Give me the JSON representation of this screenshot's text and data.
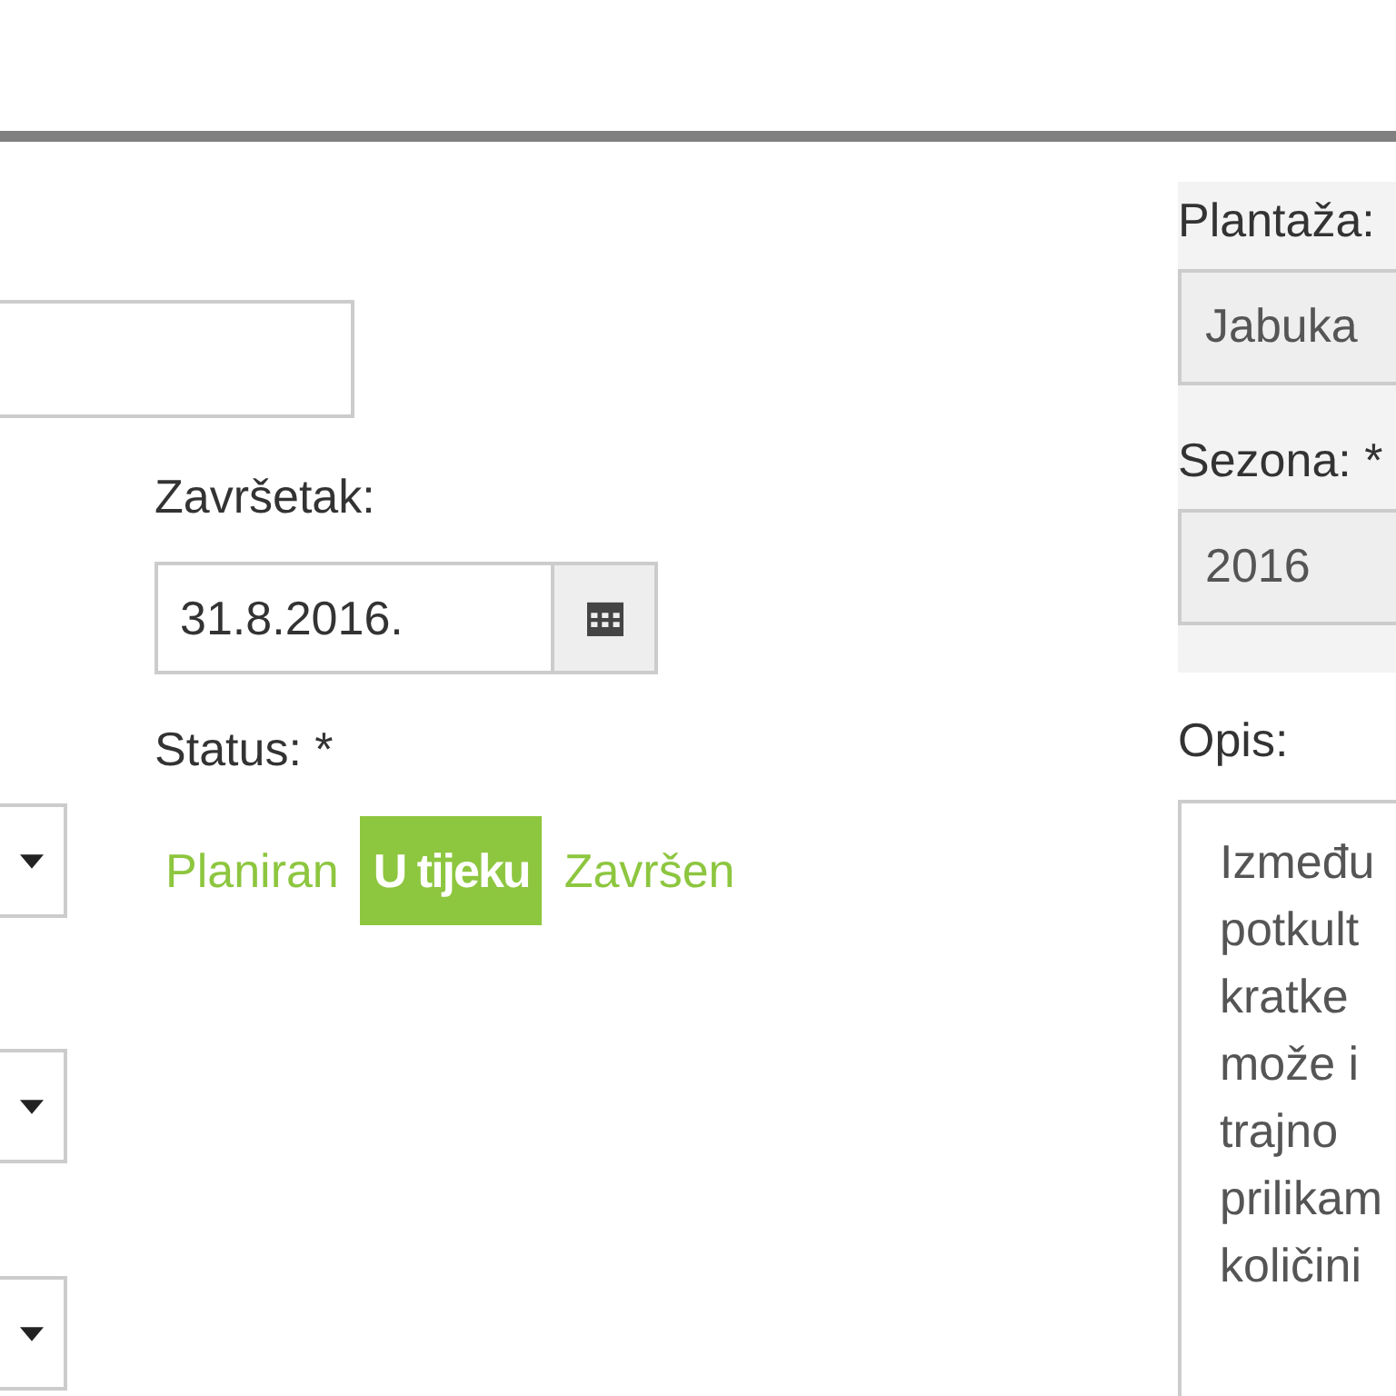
{
  "name_field": {
    "kind": "text"
  },
  "dropdowns": [
    {
      "kind": "select"
    },
    {
      "kind": "select"
    },
    {
      "kind": "select"
    }
  ],
  "end_date": {
    "label": "Završetak:",
    "value": "31.8.2016."
  },
  "status": {
    "label": "Status: *",
    "options": [
      {
        "label": "Planiran",
        "selected": false
      },
      {
        "label": "U tijeku",
        "selected": true
      },
      {
        "label": "Završen",
        "selected": false
      }
    ]
  },
  "plantation": {
    "label": "Plantaža:",
    "value": "Jabuka",
    "disabled": true
  },
  "season": {
    "label": "Sezona: *",
    "value": "2016",
    "disabled": true
  },
  "description": {
    "label": "Opis:",
    "lines": [
      "Između",
      "potkult",
      "kratke",
      "može i",
      "trajno",
      "prilikam",
      "količini"
    ]
  }
}
